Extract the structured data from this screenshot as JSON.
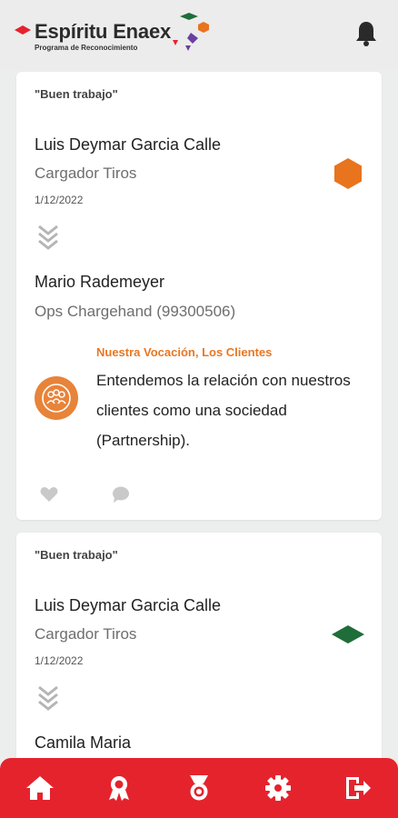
{
  "header": {
    "logo_title": "Espíritu Enaex",
    "logo_subtitle": "Programa de Reconocimiento",
    "notifications_icon": "bell-icon"
  },
  "posts": [
    {
      "quote": "\"Buen trabajo\"",
      "recipient": {
        "name": "Luis Deymar Garcia Calle",
        "role": "Cargador Tiros",
        "date": "1/12/2022"
      },
      "badge": {
        "shape": "hexagon",
        "color": "#e8741e"
      },
      "sender": {
        "name": "Mario Rademeyer",
        "role": "Ops Chargehand (99300506)"
      },
      "value": {
        "title": "Nuestra Vocación, Los Clientes",
        "description": "Entendemos la relación con nuestros clientes como una sociedad (Partnership).",
        "icon": "people-icon"
      },
      "actions": {
        "like_icon": "heart-icon",
        "comment_icon": "comment-icon"
      }
    },
    {
      "quote": "\"Buen trabajo\"",
      "recipient": {
        "name": "Luis Deymar Garcia Calle",
        "role": "Cargador Tiros",
        "date": "1/12/2022"
      },
      "badge": {
        "shape": "diamond",
        "color": "#1f6e3a"
      },
      "sender": {
        "name": "Camila Maria"
      }
    }
  ],
  "bottom_nav": {
    "items": [
      "home-icon",
      "award-icon",
      "medal-icon",
      "settings-icon",
      "logout-icon"
    ],
    "color": "#e5232d"
  }
}
